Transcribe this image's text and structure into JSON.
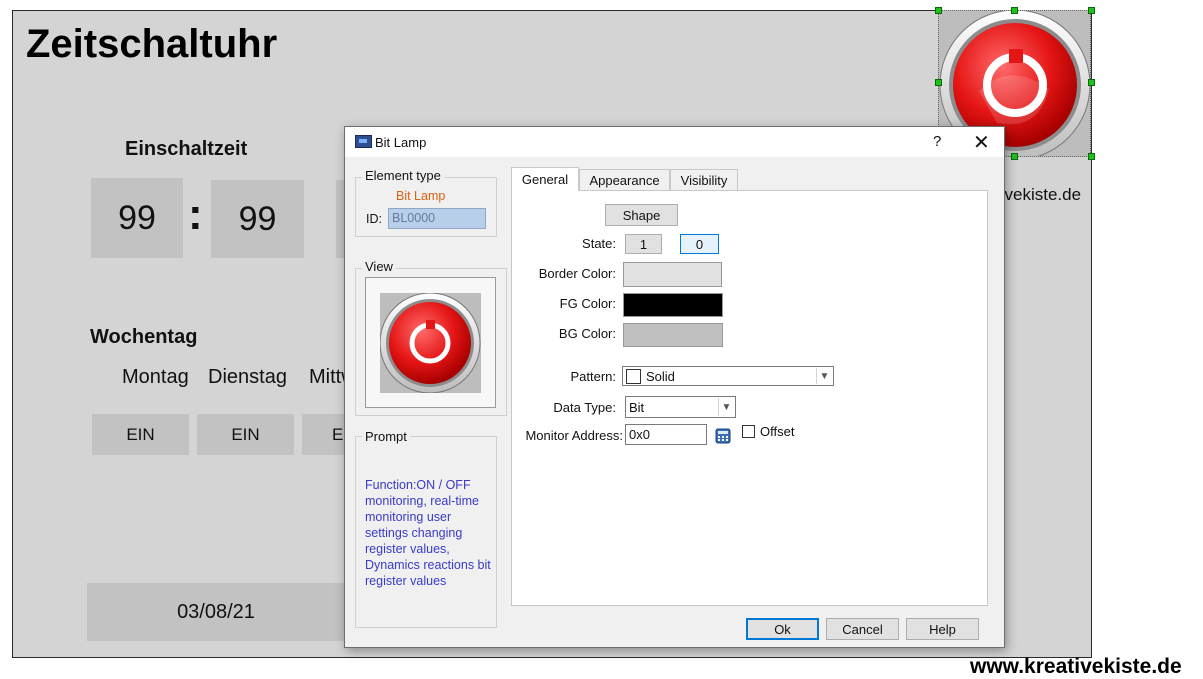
{
  "background": {
    "title": "Zeitschaltuhr",
    "einschaltzeit_label": "Einschaltzeit",
    "hours": "99",
    "colon": ":",
    "minutes": "99",
    "wochentag_label": "Wochentag",
    "days": [
      "Montag",
      "Dienstag",
      "Mittw"
    ],
    "ein_buttons": [
      "EIN",
      "EIN",
      "E"
    ],
    "date": "03/08/21",
    "watermark_partial": "tivekiste.de",
    "watermark": "www.kreativekiste.de"
  },
  "dialog": {
    "title": "Bit Lamp",
    "help": "?",
    "close": "✕",
    "element_type": {
      "group_label": "Element type",
      "name": "Bit Lamp",
      "id_label": "ID:",
      "id_value": "BL0000"
    },
    "view_label": "View",
    "prompt": {
      "label": "Prompt",
      "text": "Function:ON / OFF monitoring, real-time monitoring user settings changing register values, Dynamics reactions bit register values"
    },
    "tabs": [
      "General",
      "Appearance",
      "Visibility"
    ],
    "general": {
      "shape_button": "Shape",
      "state_label": "State:",
      "state_options": [
        "1",
        "0"
      ],
      "border_color_label": "Border Color:",
      "fg_color_label": "FG Color:",
      "bg_color_label": "BG Color:",
      "colors": {
        "border": "#e1e1e1",
        "fg": "#000000",
        "bg": "#c0c0c0"
      },
      "pattern_label": "Pattern:",
      "pattern_value": "Solid",
      "data_type_label": "Data Type:",
      "data_type_value": "Bit",
      "monitor_address_label": "Monitor Address:",
      "monitor_address_value": "0x0",
      "offset_label": "Offset"
    },
    "buttons": {
      "ok": "Ok",
      "cancel": "Cancel",
      "help": "Help"
    }
  }
}
